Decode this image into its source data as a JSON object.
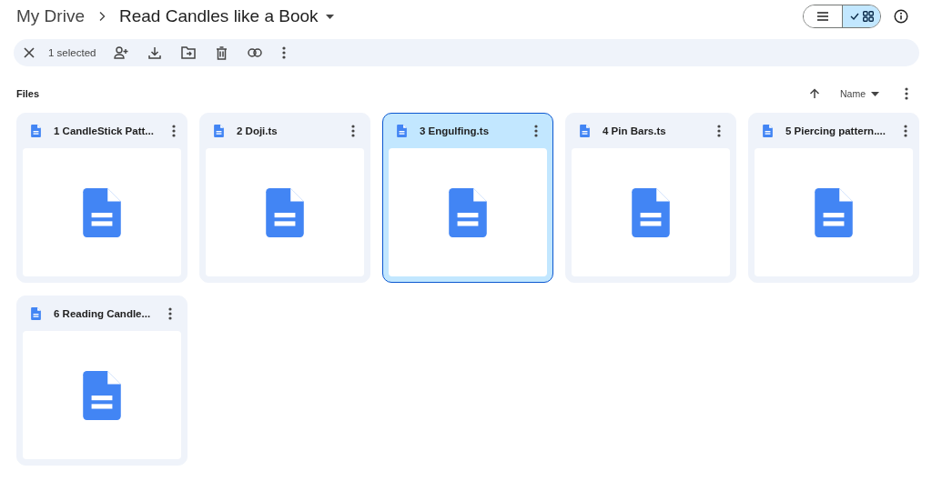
{
  "breadcrumb": [
    {
      "label": "My Drive"
    },
    {
      "label": "Read Candles like a Book"
    }
  ],
  "view_toggle": [
    {
      "kind": "list",
      "selected": false
    },
    {
      "kind": "grid",
      "selected": true
    }
  ],
  "selection_bar": {
    "count_label": "1 selected"
  },
  "section": {
    "title": "Files",
    "sort_label": "Name"
  },
  "files": [
    {
      "name": "1 CandleStick Patt...",
      "selected": false
    },
    {
      "name": "2 Doji.ts",
      "selected": false
    },
    {
      "name": "3 Engulfing.ts",
      "selected": true
    },
    {
      "name": "4 Pin Bars.ts",
      "selected": false
    },
    {
      "name": "5 Piercing pattern....",
      "selected": false
    },
    {
      "name": "6 Reading Candle...",
      "selected": false
    }
  ]
}
